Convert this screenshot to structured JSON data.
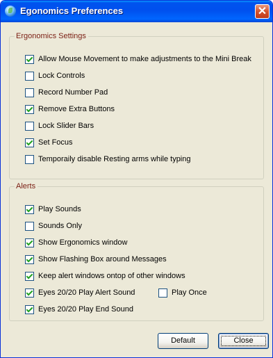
{
  "window": {
    "title": "Egonomics Preferences"
  },
  "settings_group": {
    "legend": "Ergonomics Settings",
    "items": [
      {
        "label": "Allow Mouse Movement to make adjustments to the Mini Break",
        "checked": true
      },
      {
        "label": "Lock Controls",
        "checked": false
      },
      {
        "label": "Record Number Pad",
        "checked": false
      },
      {
        "label": "Remove Extra Buttons",
        "checked": true
      },
      {
        "label": "Lock Slider Bars",
        "checked": false
      },
      {
        "label": "Set Focus",
        "checked": true
      },
      {
        "label": "Temporaily disable Resting arms while typing",
        "checked": false
      }
    ]
  },
  "alerts_group": {
    "legend": "Alerts",
    "items": [
      {
        "label": "Play Sounds",
        "checked": true
      },
      {
        "label": "Sounds Only",
        "checked": false
      },
      {
        "label": "Show Ergonomics window",
        "checked": true
      },
      {
        "label": "Show Flashing Box around Messages",
        "checked": true
      },
      {
        "label": "Keep alert windows ontop of other windows",
        "checked": true
      },
      {
        "label": "Eyes 20/20 Play Alert Sound",
        "checked": true
      },
      {
        "label": "Play Once",
        "checked": false
      },
      {
        "label": "Eyes 20/20 Play End Sound",
        "checked": true
      }
    ]
  },
  "buttons": {
    "default_label": "Default",
    "close_label": "Close"
  }
}
